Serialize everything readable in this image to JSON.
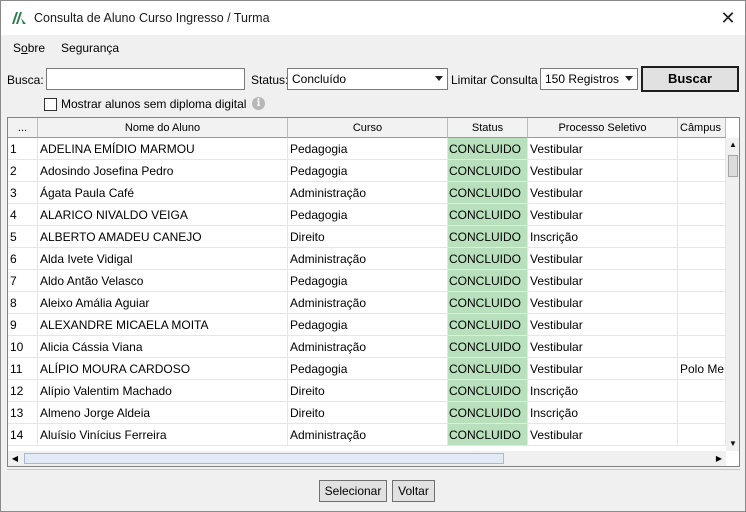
{
  "window": {
    "title": "Consulta de Aluno Curso Ingresso / Turma",
    "close_glyph": "✕"
  },
  "menu": {
    "items": [
      {
        "label_pre": "S",
        "label_ul": "o",
        "label_post": "bre"
      },
      {
        "label_pre": "Se",
        "label_ul": "g",
        "label_post": "urança"
      }
    ]
  },
  "search": {
    "busca_label": "Busca:",
    "busca_value": "",
    "status_label": "Status:",
    "status_value": "Concluído",
    "limit_label": "Limitar Consulta",
    "limit_value": "150 Registros",
    "buscar_label": "Buscar",
    "no_diploma_label": "Mostrar alunos sem diploma digital",
    "no_diploma_checked": false
  },
  "table": {
    "columns": [
      "...",
      "Nome do Aluno",
      "Curso",
      "Status",
      "Processo Seletivo",
      "Câmpus"
    ],
    "rows": [
      {
        "n": "1",
        "nome": "ADELINA EMÍDIO MARMOU",
        "curso": "Pedagogia",
        "status": "CONCLUIDO",
        "processo": "Vestibular",
        "campus": ""
      },
      {
        "n": "2",
        "nome": "Adosindo Josefina Pedro",
        "curso": "Pedagogia",
        "status": "CONCLUIDO",
        "processo": "Vestibular",
        "campus": ""
      },
      {
        "n": "3",
        "nome": "Ágata Paula Café",
        "curso": "Administração",
        "status": "CONCLUIDO",
        "processo": "Vestibular",
        "campus": ""
      },
      {
        "n": "4",
        "nome": "ALARICO NIVALDO VEIGA",
        "curso": "Pedagogia",
        "status": "CONCLUIDO",
        "processo": "Vestibular",
        "campus": ""
      },
      {
        "n": "5",
        "nome": "ALBERTO AMADEU CANEJO",
        "curso": "Direito",
        "status": "CONCLUIDO",
        "processo": "Inscrição",
        "campus": ""
      },
      {
        "n": "6",
        "nome": "Alda Ivete Vidigal",
        "curso": "Administração",
        "status": "CONCLUIDO",
        "processo": "Vestibular",
        "campus": ""
      },
      {
        "n": "7",
        "nome": "Aldo Antão Velasco",
        "curso": "Pedagogia",
        "status": "CONCLUIDO",
        "processo": "Vestibular",
        "campus": ""
      },
      {
        "n": "8",
        "nome": "Aleixo Amália Aguiar",
        "curso": "Administração",
        "status": "CONCLUIDO",
        "processo": "Vestibular",
        "campus": ""
      },
      {
        "n": "9",
        "nome": "ALEXANDRE MICAELA MOITA",
        "curso": "Pedagogia",
        "status": "CONCLUIDO",
        "processo": "Vestibular",
        "campus": ""
      },
      {
        "n": "10",
        "nome": "Alicia Cássia Viana",
        "curso": "Administração",
        "status": "CONCLUIDO",
        "processo": "Vestibular",
        "campus": ""
      },
      {
        "n": "11",
        "nome": "ALÍPIO MOURA CARDOSO",
        "curso": "Pedagogia",
        "status": "CONCLUIDO",
        "processo": "Vestibular",
        "campus": "Polo Me"
      },
      {
        "n": "12",
        "nome": "Alípio Valentim Machado",
        "curso": "Direito",
        "status": "CONCLUIDO",
        "processo": "Inscrição",
        "campus": ""
      },
      {
        "n": "13",
        "nome": "Almeno Jorge Aldeia",
        "curso": "Direito",
        "status": "CONCLUIDO",
        "processo": "Inscrição",
        "campus": ""
      },
      {
        "n": "14",
        "nome": "Aluísio Vinícius Ferreira",
        "curso": "Administração",
        "status": "CONCLUIDO",
        "processo": "Vestibular",
        "campus": ""
      }
    ]
  },
  "footer": {
    "selecionar_label": "Selecionar",
    "voltar_label": "Voltar"
  },
  "colors": {
    "status_cell": "#b8e0bd",
    "accent": "#1e1e1e"
  }
}
